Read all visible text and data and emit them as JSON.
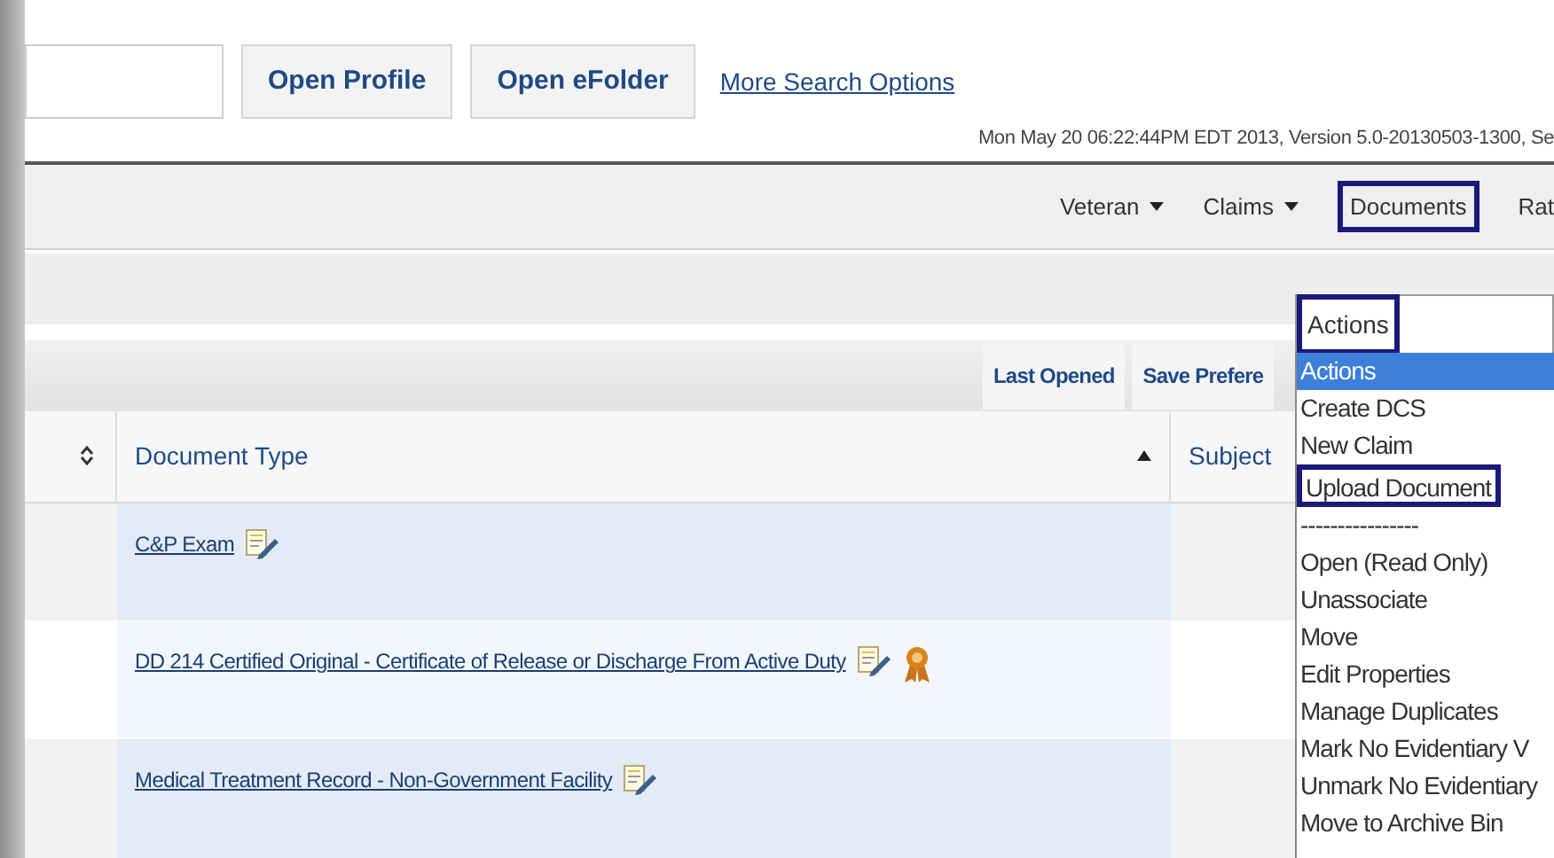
{
  "search": {
    "buttons": [
      "Open Profile",
      "Open eFolder"
    ],
    "link": "More Search Options"
  },
  "timestamp": "Mon May 20 06:22:44PM EDT 2013, Version 5.0-20130503-1300, Se",
  "nav": [
    {
      "label": "Veteran",
      "dropdown": true,
      "selected": false
    },
    {
      "label": "Claims",
      "dropdown": true,
      "selected": false
    },
    {
      "label": "Documents",
      "dropdown": false,
      "selected": true
    },
    {
      "label": "Rat",
      "dropdown": false,
      "selected": false
    }
  ],
  "actions_select": {
    "value": "Actions",
    "highlighted": true
  },
  "toolbar": {
    "buttons": [
      "Last Opened",
      "Save Prefere"
    ]
  },
  "table": {
    "columns": [
      {
        "sortable": true,
        "sorted_ascending": false
      },
      {
        "label": "Document Type",
        "sorted_ascending": true
      },
      {
        "label": "Subject",
        "sortable": false,
        "sorted_ascending": false
      }
    ],
    "rows": [
      {
        "document_type": "C&P Exam",
        "certified": false
      },
      {
        "document_type": "DD 214 Certified Original - Certificate of Release or Discharge From Active Duty",
        "certified": true
      },
      {
        "document_type": "Medical Treatment Record - Non-Government Facility",
        "certified": false
      }
    ]
  },
  "dropdown": {
    "options": [
      {
        "label": "Actions",
        "selected": true,
        "highlighted": false
      },
      {
        "label": "Create DCS",
        "selected": false,
        "highlighted": false
      },
      {
        "label": "New Claim",
        "selected": false,
        "highlighted": false
      },
      {
        "label": "Upload Document",
        "selected": false,
        "highlighted": true
      },
      {
        "label": "----------------",
        "selected": false,
        "highlighted": false
      },
      {
        "label": "Open (Read Only)",
        "selected": false,
        "highlighted": false
      },
      {
        "label": "Unassociate",
        "selected": false,
        "highlighted": false
      },
      {
        "label": "Move",
        "selected": false,
        "highlighted": false
      },
      {
        "label": "Edit Properties",
        "selected": false,
        "highlighted": false
      },
      {
        "label": "Manage Duplicates",
        "selected": false,
        "highlighted": false
      },
      {
        "label": "Mark No Evidentiary V",
        "selected": false,
        "highlighted": false
      },
      {
        "label": "Unmark No Evidentiary",
        "selected": false,
        "highlighted": false
      },
      {
        "label": "Move to Archive Bin",
        "selected": false,
        "highlighted": false
      }
    ]
  }
}
